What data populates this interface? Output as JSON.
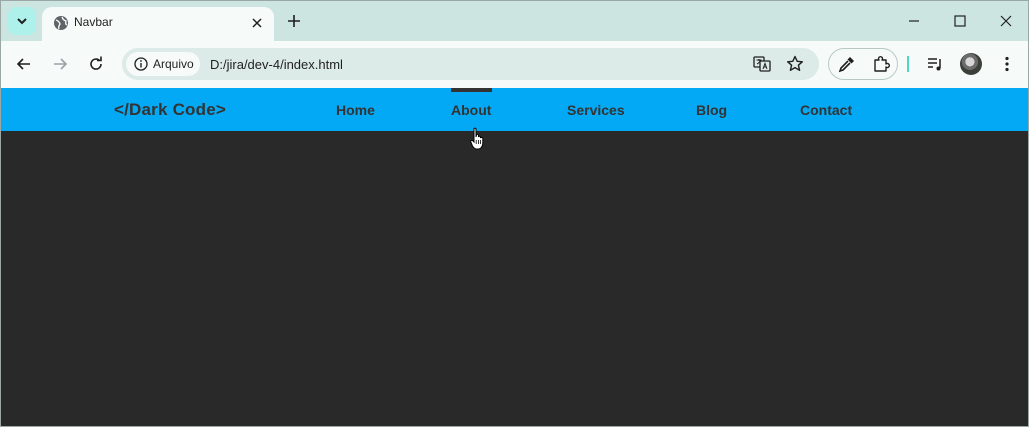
{
  "browser": {
    "tab": {
      "title": "Navbar"
    },
    "omnibox": {
      "security_chip": "Arquivo",
      "url": "D:/jira/dev-4/index.html"
    },
    "icons": [
      "tab-search-icon",
      "globe-icon",
      "close-icon",
      "plus-icon",
      "minimize-icon",
      "maximize-icon",
      "window-close-icon",
      "back-icon",
      "forward-icon",
      "reload-icon",
      "info-icon",
      "translate-icon",
      "star-icon",
      "eyedropper-icon",
      "puzzle-icon",
      "media-icon",
      "avatar",
      "kebab-menu-icon"
    ]
  },
  "site": {
    "brand": "</Dark Code>",
    "nav": [
      {
        "label": "Home"
      },
      {
        "label": "About",
        "active": true
      },
      {
        "label": "Services"
      },
      {
        "label": "Blog"
      },
      {
        "label": "Contact"
      }
    ],
    "colors": {
      "navbar": "#03a9f4",
      "text": "#333333",
      "background": "#292929"
    }
  }
}
